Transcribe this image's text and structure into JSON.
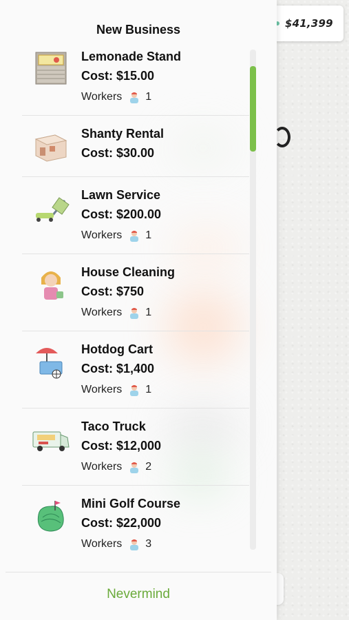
{
  "hud": {
    "money": "$41,399"
  },
  "panel": {
    "title": "New Business",
    "cancel_label": "Nevermind"
  },
  "businesses": [
    {
      "name": "Lemonade Stand",
      "cost": "Cost: $15.00",
      "workers_label": "Workers",
      "workers": "1",
      "icon": "lemonade-stand-icon"
    },
    {
      "name": "Shanty Rental",
      "cost": "Cost: $30.00",
      "icon": "shanty-icon"
    },
    {
      "name": "Lawn Service",
      "cost": "Cost: $200.00",
      "workers_label": "Workers",
      "workers": "1",
      "icon": "lawn-mower-icon"
    },
    {
      "name": "House Cleaning",
      "cost": "Cost: $750",
      "workers_label": "Workers",
      "workers": "1",
      "icon": "house-cleaner-icon"
    },
    {
      "name": "Hotdog Cart",
      "cost": "Cost: $1,400",
      "workers_label": "Workers",
      "workers": "1",
      "icon": "hotdog-cart-icon"
    },
    {
      "name": "Taco Truck",
      "cost": "Cost: $12,000",
      "workers_label": "Workers",
      "workers": "2",
      "icon": "taco-truck-icon"
    },
    {
      "name": "Mini Golf Course",
      "cost": "Cost: $22,000",
      "workers_label": "Workers",
      "workers": "3",
      "icon": "mini-golf-icon"
    }
  ],
  "colors": {
    "accent_green": "#6aaa3a",
    "scroll_thumb": "#7cc04a"
  }
}
